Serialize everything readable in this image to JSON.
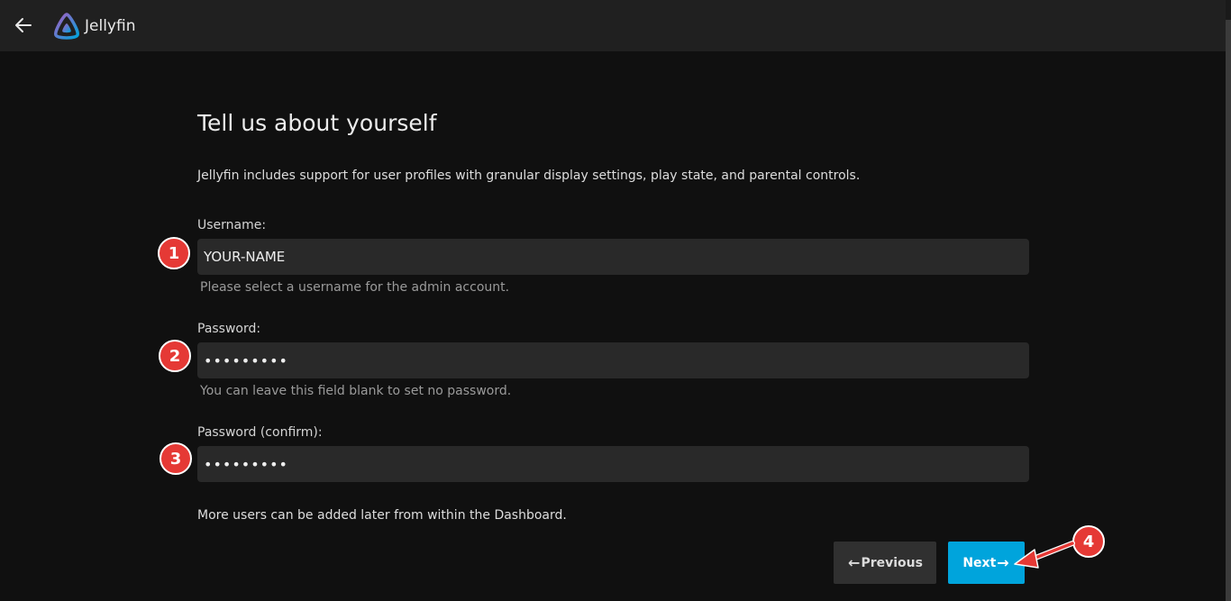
{
  "app": {
    "name": "Jellyfin"
  },
  "page": {
    "title": "Tell us about yourself",
    "intro": "Jellyfin includes support for user profiles with granular display settings, play state, and parental controls.",
    "footnote": "More users can be added later from within the Dashboard."
  },
  "form": {
    "username": {
      "label": "Username:",
      "value": "YOUR-NAME",
      "help": "Please select a username for the admin account."
    },
    "password": {
      "label": "Password:",
      "value": "•••••••••",
      "help": "You can leave this field blank to set no password."
    },
    "password_confirm": {
      "label": "Password (confirm):",
      "value": "•••••••••"
    }
  },
  "buttons": {
    "previous": "Previous",
    "next": "Next",
    "arrow_left": "←",
    "arrow_right": "→"
  },
  "annotations": {
    "step1": "1",
    "step2": "2",
    "step3": "3",
    "step4": "4",
    "color": "#e53935"
  },
  "colors": {
    "accent": "#00a4dc",
    "header_bg": "#202020",
    "page_bg": "#101010",
    "input_bg": "#292929"
  },
  "icons": {
    "back": "back-arrow-icon",
    "logo": "jellyfin-logo-icon"
  }
}
